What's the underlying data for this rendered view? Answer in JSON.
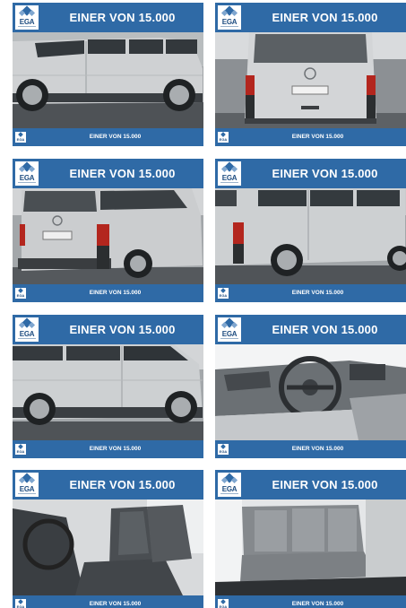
{
  "listing": {
    "tiles": [
      {
        "banner": "EINER VON 15.000",
        "logo": "EGA",
        "footer": "EINER VON 15.000",
        "view": "side-left-rear"
      },
      {
        "banner": "EINER VON 15.000",
        "logo": "EGA",
        "footer": "EINER VON 15.000",
        "view": "rear"
      },
      {
        "banner": "EINER VON 15.000",
        "logo": "EGA",
        "footer": "EINER VON 15.000",
        "view": "rear-quarter-left"
      },
      {
        "banner": "EINER VON 15.000",
        "logo": "EGA",
        "footer": "EINER VON 15.000",
        "view": "rear-quarter-right"
      },
      {
        "banner": "EINER VON 15.000",
        "logo": "EGA",
        "footer": "EINER VON 15.000",
        "view": "side-right"
      },
      {
        "banner": "EINER VON 15.000",
        "logo": "EGA",
        "footer": "EINER VON 15.000",
        "view": "dashboard"
      },
      {
        "banner": "EINER VON 15.000",
        "logo": "EGA",
        "footer": "EINER VON 15.000",
        "view": "front-seats"
      },
      {
        "banner": "EINER VON 15.000",
        "logo": "EGA",
        "footer": "EINER VON 15.000",
        "view": "rear-bench"
      }
    ]
  },
  "colors": {
    "banner": "#2f6aa6",
    "van_silver": "#c8cacc",
    "tile_bg": "#ffffff"
  }
}
